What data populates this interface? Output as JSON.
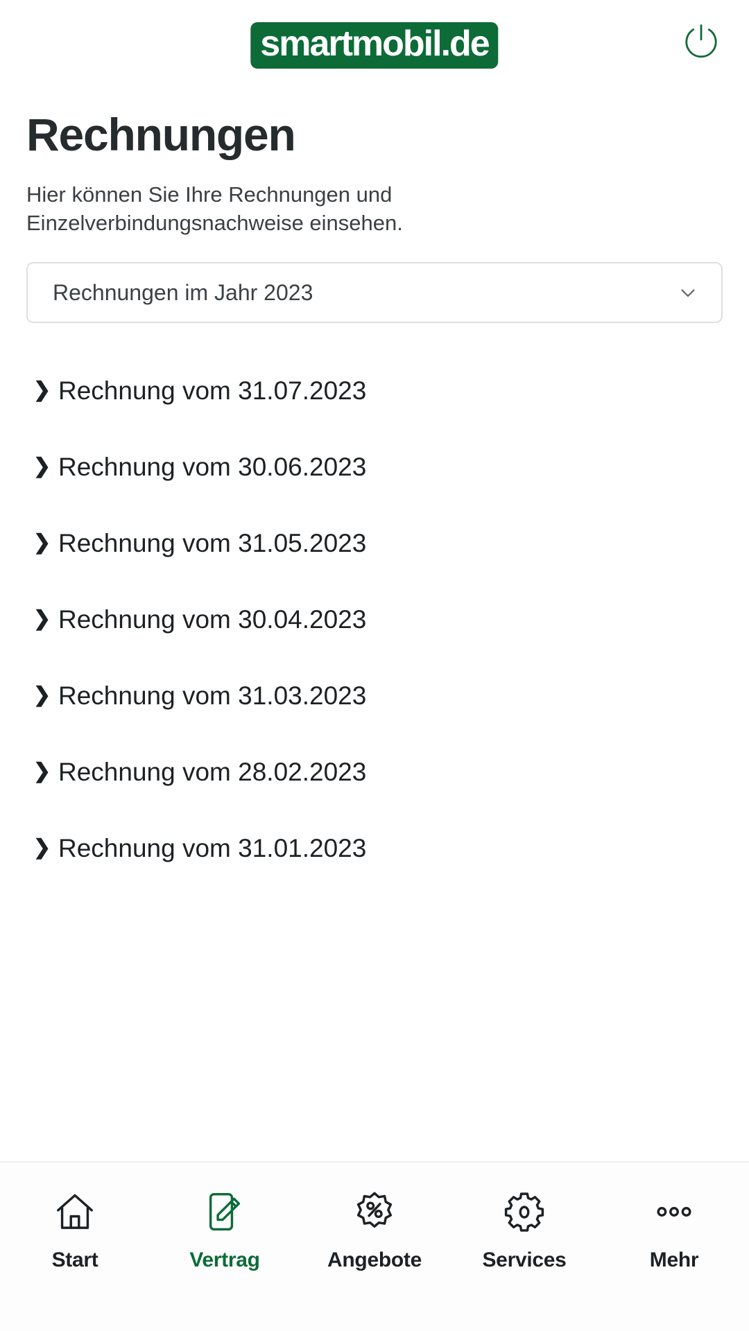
{
  "brand": {
    "name": "smartmobil.de",
    "logo_bg_color": "#0d6b38",
    "logo_text_color": "#ffffff"
  },
  "header": {
    "power_icon": "power-icon",
    "power_icon_color": "#15693d"
  },
  "page": {
    "title": "Rechnungen",
    "description": "Hier können Sie Ihre Rechnungen und Einzelverbindungsnachweise einsehen."
  },
  "year_filter": {
    "selected": "Rechnungen im Jahr 2023",
    "chevron_icon": "chevron-down-icon",
    "options": [
      "Rechnungen im Jahr 2023"
    ]
  },
  "invoices": {
    "marker_icon": "chevron-right-icon",
    "items": [
      {
        "label": "Rechnung vom 31.07.2023"
      },
      {
        "label": "Rechnung vom 30.06.2023"
      },
      {
        "label": "Rechnung vom 31.05.2023"
      },
      {
        "label": "Rechnung vom 30.04.2023"
      },
      {
        "label": "Rechnung vom 31.03.2023"
      },
      {
        "label": "Rechnung vom 28.02.2023"
      },
      {
        "label": "Rechnung vom 31.01.2023"
      }
    ]
  },
  "bottom_nav": {
    "active_color": "#0d6b38",
    "inactive_color": "#1d2124",
    "items": [
      {
        "label": "Start",
        "icon": "home-icon",
        "active": false
      },
      {
        "label": "Vertrag",
        "icon": "contract-edit-icon",
        "active": true
      },
      {
        "label": "Angebote",
        "icon": "percent-badge-icon",
        "active": false
      },
      {
        "label": "Services",
        "icon": "gear-icon",
        "active": false
      },
      {
        "label": "Mehr",
        "icon": "ellipsis-icon",
        "active": false
      }
    ]
  }
}
